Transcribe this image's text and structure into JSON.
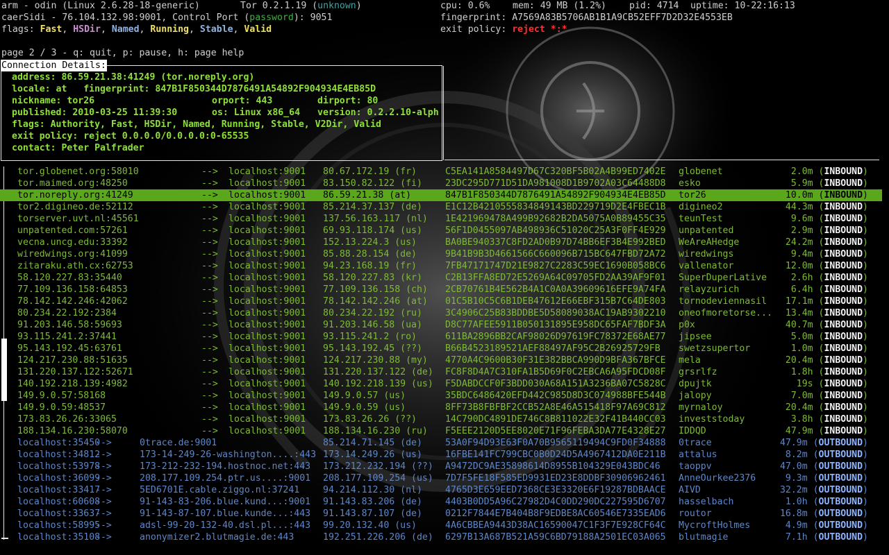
{
  "header": {
    "title": "arm - odin (Linux 2.6.28-18-generic)",
    "tor_version": "Tor 0.2.1.19 (",
    "tor_status": "unknown",
    "tor_close": ")",
    "cpu": "cpu: 0.6%",
    "mem": "mem: 49 MB (1.2%)",
    "pid": "pid: 4714",
    "uptime": "uptime: 10-22:16:13",
    "relay": "caerSidi - 76.104.132.98:9001, Control Port (",
    "password": "password",
    "relay_end": "): 9051",
    "fingerprint": "fingerprint: A7569A83B5706AB1B1A9CB52EFF7D2D32E4553EB",
    "flags_label": "flags: ",
    "flags": [
      "Fast",
      "HSDir",
      "Named",
      "Running",
      "Stable",
      "Valid"
    ],
    "exit_label": "exit policy: ",
    "exit_value": "reject *:*",
    "page": "page 2 / 3 - q: quit, p: pause, h: page help"
  },
  "details": {
    "title": "Connection Details:",
    "address": "address: 86.59.21.38:41249 (tor.noreply.org)",
    "locale": "locale: at   fingerprint: 847B1F850344D7876491A54892F904934E4EB85D",
    "nickname": "nickname: tor26",
    "orport": "orport: 443",
    "dirport": "dirport: 80",
    "published": "published: 2010-03-25 11:39:30",
    "os": "os: Linux x86_64",
    "version": "version: 0.2.2.10-alph",
    "flags": "flags: Authority, Fast, HSDir, Named, Running, Stable, V2Dir, Valid",
    "exit_policy": "exit policy: reject 0.0.0.0/0.0.0.0:0-65535",
    "contact": "contact: Peter Palfrader"
  },
  "connections": [
    {
      "src": "tor.globenet.org:58010",
      "arrow": "-->",
      "dst": "localhost:9001",
      "ip": "80.67.172.19 (fr)",
      "fp": "C5EA141A8584497D67C320BF5B02A4B99ED7402E",
      "nick": "globenet",
      "time": "2.0m",
      "type": "INBOUND",
      "kind": "in"
    },
    {
      "src": "tor.maimed.org:48250",
      "arrow": "-->",
      "dst": "localhost:9001",
      "ip": "83.150.82.122 (fi)",
      "fp": "23DC295D771D51DA981008D1B9702A03C64488D8",
      "nick": "esko",
      "time": "5.9m",
      "type": "INBOUND",
      "kind": "in"
    },
    {
      "src": "tor.noreply.org:41249",
      "arrow": "-->",
      "dst": "localhost:9001",
      "ip": "86.59.21.38 (at)",
      "fp": "847B1F850344D7876491A54892F904934E4EB85D",
      "nick": "tor26",
      "time": "10.0m",
      "type": "INBOUND",
      "kind": "sel"
    },
    {
      "src": "tor2.digineo.de:52112",
      "arrow": "-->",
      "dst": "localhost:9001",
      "ip": "85.214.37.137 (de)",
      "fp": "E1C12B421055583484914 3BD229719D2E4FBEC1B",
      "nick": "digineo2",
      "time": "44.3m",
      "type": "INBOUND",
      "kind": "in"
    },
    {
      "src": "torserver.uvt.nl:45561",
      "arrow": "-->",
      "dst": "localhost:9001",
      "ip": "137.56.163.117 (nl)",
      "fp": "1E421969478A499B92682B2DA5075A0B89455C35",
      "nick": "teunTest",
      "time": "9.6m",
      "type": "INBOUND",
      "kind": "in"
    },
    {
      "src": "unpatented.com:57261",
      "arrow": "-->",
      "dst": "localhost:9001",
      "ip": "69.93.118.174 (us)",
      "fp": "56F1D0455097AB498936C51020C25A3F0FF4E929",
      "nick": "unpatented",
      "time": "2.9m",
      "type": "INBOUND",
      "kind": "in"
    },
    {
      "src": "vecna.uncg.edu:33392",
      "arrow": "-->",
      "dst": "localhost:9001",
      "ip": "152.13.224.3 (us)",
      "fp": "BA0BE940337C8FD2AD0B97D74BB6EF3B4E992BED",
      "nick": "WeAreAHedge",
      "time": "24.2m",
      "type": "INBOUND",
      "kind": "in"
    },
    {
      "src": "wiredwings.org:41099",
      "arrow": "-->",
      "dst": "localhost:9001",
      "ip": "85.88.28.154 (de)",
      "fp": "9B41B9B3D4661566C660096B715BC647FBD72A72",
      "nick": "wiredwings",
      "time": "9.4m",
      "type": "INBOUND",
      "kind": "in"
    },
    {
      "src": "zitaraku.ath.cx:62753",
      "arrow": "-->",
      "dst": "localhost:9001",
      "ip": "94.23.168.19 (fr)",
      "fp": "7FB47171747D21E9827C2283C59EC1690B058BC6",
      "nick": "vallenator",
      "time": "12.0m",
      "type": "INBOUND",
      "kind": "in"
    },
    {
      "src": "58.120.227.83:35440",
      "arrow": "-->",
      "dst": "localhost:9001",
      "ip": "58.120.227.83 (kr)",
      "fp": "C2B13FFA8ED72E5269A64C09705FD2AA39AF9F01",
      "nick": "SuperDuperLative",
      "time": "2.6h",
      "type": "INBOUND",
      "kind": "in"
    },
    {
      "src": "77.109.136.158:64853",
      "arrow": "-->",
      "dst": "localhost:9001",
      "ip": "77.109.136.158 (ch)",
      "fp": "2CB70761B4E562B4A1C0A0A39609616EFE9A74FA",
      "nick": "relayzurich",
      "time": "6.4h",
      "type": "INBOUND",
      "kind": "in"
    },
    {
      "src": "78.142.142.246:42062",
      "arrow": "-->",
      "dst": "localhost:9001",
      "ip": "78.142.142.246 (at)",
      "fp": "01C5B10C5C6B1DEB47612E66EBF315B7C64DE803",
      "nick": "tornodeviennasil",
      "time": "17.1m",
      "type": "INBOUND",
      "kind": "in"
    },
    {
      "src": "80.234.22.192:2384",
      "arrow": "-->",
      "dst": "localhost:9001",
      "ip": "80.234.22.192 (ru)",
      "fp": "3C4906C25B83BDDBE5D58089038AC19AB9302210",
      "nick": "oneofmoretorse...",
      "time": "13.4m",
      "type": "INBOUND",
      "kind": "in"
    },
    {
      "src": "91.203.146.58:59693",
      "arrow": "-->",
      "dst": "localhost:9001",
      "ip": "91.203.146.58 (ua)",
      "fp": "D8C77AFEE5911B050131895E958DC65FAF7BDF3A",
      "nick": "p0x",
      "time": "40.7m",
      "type": "INBOUND",
      "kind": "in"
    },
    {
      "src": "93.115.241.2:37441",
      "arrow": "-->",
      "dst": "localhost:9001",
      "ip": "93.115.241.2 (ro)",
      "fp": "611BA2896BB2CAF98026D97619FC78372E68AE77",
      "nick": "jipsee",
      "time": "5.0m",
      "type": "INBOUND",
      "kind": "in"
    },
    {
      "src": "95.143.192.45:63761",
      "arrow": "-->",
      "dst": "localhost:9001",
      "ip": "95.143.192.45 (??)",
      "fp": "B66B4523189521AEF88497AF95C2B26925729FB",
      "nick": "swetzsupertor",
      "time": "1.0m",
      "type": "INBOUND",
      "kind": "in"
    },
    {
      "src": "124.217.230.88:51635",
      "arrow": "-->",
      "dst": "localhost:9001",
      "ip": "124.217.230.88 (my)",
      "fp": "4770A4C9600B30F31E382BBCA990D9BFA367BFCE",
      "nick": "mela",
      "time": "20.4m",
      "type": "INBOUND",
      "kind": "in"
    },
    {
      "src": "131.220.137.122:52671",
      "arrow": "-->",
      "dst": "localhost:9001",
      "ip": "131.220.137.122 (de)",
      "fp": "FC8F8D4A7C310FA1B5D69F0C2EBCA6A95FDCD08F",
      "nick": "grsrlfz",
      "time": "1.8h",
      "type": "INBOUND",
      "kind": "in"
    },
    {
      "src": "140.192.218.139:4982",
      "arrow": "-->",
      "dst": "localhost:9001",
      "ip": "140.192.218.139 (us)",
      "fp": "F5DABDCCF0F3BDD030A68A151A3236BA07C5828C",
      "nick": "dpujtk",
      "time": "19s",
      "type": "INBOUND",
      "kind": "in"
    },
    {
      "src": "149.9.0.57:58168",
      "arrow": "-->",
      "dst": "localhost:9001",
      "ip": "149.9.0.57 (us)",
      "fp": "35BDC6486420EFD442C985D8D3C074988BFE544B",
      "nick": "jalopy",
      "time": "7.0m",
      "type": "INBOUND",
      "kind": "in"
    },
    {
      "src": "149.9.0.59:48537",
      "arrow": "-->",
      "dst": "localhost:9001",
      "ip": "149.9.0.59 (us)",
      "fp": "8FF73B8FBFBF2CCB52A8E46A515418F97A69C812",
      "nick": "myrnaloy",
      "time": "20.4m",
      "type": "INBOUND",
      "kind": "in"
    },
    {
      "src": "173.83.26.26:33065",
      "arrow": "-->",
      "dst": "localhost:9001",
      "ip": "173.83.26.26 (??)",
      "fp": "14C790DC4891DE746C8B811022E32F41B440CC03",
      "nick": "investstoday",
      "time": "3.8h",
      "type": "INBOUND",
      "kind": "in"
    },
    {
      "src": "188.134.16.230:58070",
      "arrow": "-->",
      "dst": "localhost:9001",
      "ip": "188.134.16.230 (ru)",
      "fp": "F5EEE2120D5EE8020E71F96FEBA3DA77E4328E27",
      "nick": "IDDQD",
      "time": "47.9m",
      "type": "INBOUND",
      "kind": "in"
    },
    {
      "src": "localhost:35450",
      "arrow": "-->",
      "dst": "0trace.de:9001",
      "ip": "85.214.71.145 (de)",
      "fp": "53A0F94D93E63F0A70B9565119494C9FD0F34888",
      "nick": "0trace",
      "time": "47.9m",
      "type": "OUTBOUND",
      "kind": "out"
    },
    {
      "src": "localhost:34812",
      "arrow": "-->",
      "dst": "173-14-249-26-washington....:443",
      "ip": "173.14.249.26 (us)",
      "fp": "16FBE141FC799CBC0B0D24D5A4967412DA0E211B",
      "nick": "attalus",
      "time": "8.2m",
      "type": "OUTBOUND",
      "kind": "out"
    },
    {
      "src": "localhost:53978",
      "arrow": "-->",
      "dst": "173-212-232-194.hostnoc.net:443",
      "ip": "173.212.232.194 (??)",
      "fp": "A9472DC9AE35898614D8955B104329E043BDC46",
      "nick": "taoppv",
      "time": "47.0m",
      "type": "OUTBOUND",
      "kind": "out"
    },
    {
      "src": "localhost:36099",
      "arrow": "-->",
      "dst": "208.177.109.254.ptr.us....:9001",
      "ip": "208.177.109.254 (us)",
      "fp": "7D7F5FE18F585ED9931ED23E8DDBF30906962461",
      "nick": "AnneOurkee2376",
      "time": "9.3m",
      "type": "OUTBOUND",
      "kind": "out"
    },
    {
      "src": "localhost:33417",
      "arrow": "-->",
      "dst": "5ED6701E.cable.ziggo.nl:37241",
      "ip": "94.214.112.30 (nl)",
      "fp": "4765D3E659EED7368CE3E3320E6F19287BDBAACE",
      "nick": "AIVD",
      "time": "32.2m",
      "type": "OUTBOUND",
      "kind": "out"
    },
    {
      "src": "localhost:60608",
      "arrow": "-->",
      "dst": "91-143-83-206.blue.kund...:9001",
      "ip": "91.143.83.206 (de)",
      "fp": "4403B0DD5A96C27982D4C0DD290DC227595D6707",
      "nick": "hasselbach",
      "time": "1.0h",
      "type": "OUTBOUND",
      "kind": "out"
    },
    {
      "src": "localhost:33637",
      "arrow": "-->",
      "dst": "91-143-87-107.blue.kunde...:443",
      "ip": "91.143.87.107 (de)",
      "fp": "0212F7844E7B404B8F9EDBE8AC60546E7335EAD6",
      "nick": "routor",
      "time": "16.8m",
      "type": "OUTBOUND",
      "kind": "out"
    },
    {
      "src": "localhost:58995",
      "arrow": "-->",
      "dst": "adsl-99-20-132-40.dsl.pl...:443",
      "ip": "99.20.132.40 (us)",
      "fp": "4A6CBBEA9443D38AC16590047C1F3F7E928CF64C",
      "nick": "MycroftHolmes",
      "time": "4.9m",
      "type": "OUTBOUND",
      "kind": "out"
    },
    {
      "src": "localhost:35108",
      "arrow": "-->",
      "dst": "anonymizer2.blutmagie.de:443",
      "ip": "192.251.226.206 (de)",
      "fp": "6297B13A687B521A59C6BD79188A2501EC03A065",
      "nick": "blutmagie",
      "time": "7.1h",
      "type": "OUTBOUND",
      "kind": "out"
    }
  ]
}
